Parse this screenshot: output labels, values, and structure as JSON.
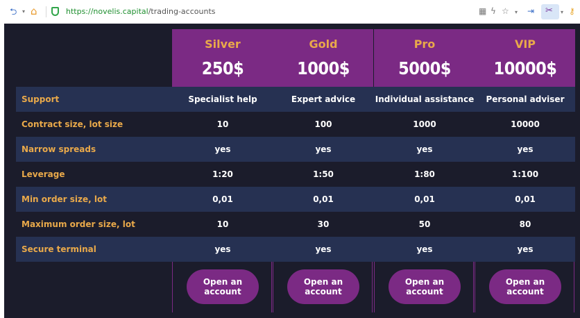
{
  "browser": {
    "url_host": "https://novelis.capital",
    "url_path": "/trading-accounts"
  },
  "plans": [
    {
      "name": "Silver",
      "price": "250$"
    },
    {
      "name": "Gold",
      "price": "1000$"
    },
    {
      "name": "Pro",
      "price": "5000$"
    },
    {
      "name": "VIP",
      "price": "10000$"
    }
  ],
  "rows": [
    {
      "label": "Support",
      "values": [
        "Specialist help",
        "Expert advice",
        "Individual assistance",
        "Personal adviser"
      ]
    },
    {
      "label": "Contract size, lot size",
      "values": [
        "10",
        "100",
        "1000",
        "10000"
      ]
    },
    {
      "label": "Narrow spreads",
      "values": [
        "yes",
        "yes",
        "yes",
        "yes"
      ]
    },
    {
      "label": "Leverage",
      "values": [
        "1:20",
        "1:50",
        "1:80",
        "1:100"
      ]
    },
    {
      "label": "Min order size, lot",
      "values": [
        "0,01",
        "0,01",
        "0,01",
        "0,01"
      ]
    },
    {
      "label": "Maximum order size, lot",
      "values": [
        "10",
        "30",
        "50",
        "80"
      ]
    },
    {
      "label": "Secure terminal",
      "values": [
        "yes",
        "yes",
        "yes",
        "yes"
      ]
    }
  ],
  "open_account_label": "Open an account",
  "colors": {
    "accent": "#7b2a84",
    "label": "#e9a94a",
    "background": "#1b1c2b",
    "row_alt": "#263152"
  }
}
